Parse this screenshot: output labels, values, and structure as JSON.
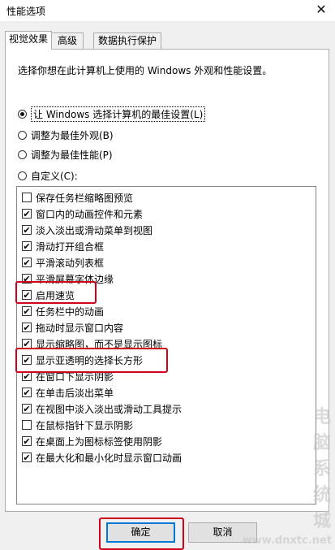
{
  "window": {
    "title": "性能选项",
    "close_glyph": "✕"
  },
  "tabs": [
    {
      "label": "视觉效果",
      "active": true
    },
    {
      "label": "高级",
      "active": false
    },
    {
      "label": "数据执行保护",
      "active": false
    }
  ],
  "description": "选择你想在此计算机上使用的 Windows 外观和性能设置。",
  "radios": [
    {
      "label": "让 Windows 选择计算机的最佳设置(L)",
      "selected": true
    },
    {
      "label": "调整为最佳外观(B)",
      "selected": false
    },
    {
      "label": "调整为最佳性能(P)",
      "selected": false
    },
    {
      "label": "自定义(C):",
      "selected": false
    }
  ],
  "options": [
    {
      "label": "保存任务栏缩略图预览",
      "checked": false
    },
    {
      "label": "窗口内的动画控件和元素",
      "checked": true
    },
    {
      "label": "淡入淡出或滑动菜单到视图",
      "checked": true
    },
    {
      "label": "滑动打开组合框",
      "checked": true
    },
    {
      "label": "平滑滚动列表框",
      "checked": true
    },
    {
      "label": "平滑屏幕字体边缘",
      "checked": true
    },
    {
      "label": "启用速览",
      "checked": true
    },
    {
      "label": "任务栏中的动画",
      "checked": true
    },
    {
      "label": "拖动时显示窗口内容",
      "checked": true
    },
    {
      "label": "显示缩略图，而不是显示图标",
      "checked": true
    },
    {
      "label": "显示亚透明的选择长方形",
      "checked": true
    },
    {
      "label": "在窗口下显示阴影",
      "checked": true
    },
    {
      "label": "在单击后淡出菜单",
      "checked": true
    },
    {
      "label": "在视图中淡入淡出或滑动工具提示",
      "checked": true
    },
    {
      "label": "在鼠标指针下显示阴影",
      "checked": false
    },
    {
      "label": "在桌面上为图标标签使用阴影",
      "checked": true
    },
    {
      "label": "在最大化和最小化时显示窗口动画",
      "checked": true
    }
  ],
  "buttons": {
    "ok": "确定",
    "cancel": "取消"
  },
  "watermark": {
    "main": "电脑系统城",
    "url": "www.dnxtc.net"
  },
  "highlight_color": "#d0021b"
}
